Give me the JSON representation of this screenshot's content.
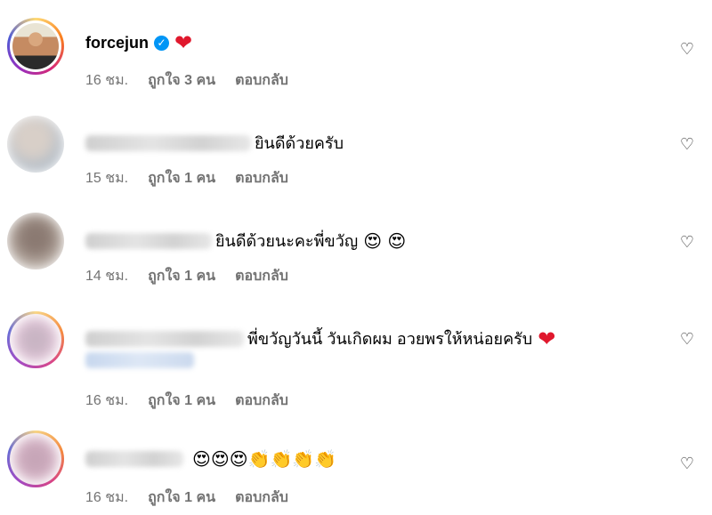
{
  "comments": [
    {
      "username": "forcejun",
      "verified": true,
      "text": "",
      "emoji": "❤",
      "time": "16 ชม.",
      "likes": "ถูกใจ 3 คน",
      "reply": "ตอบกลับ"
    },
    {
      "username": "",
      "text": "ยินดีด้วยครับ",
      "emoji": "",
      "time": "15 ชม.",
      "likes": "ถูกใจ 1 คน",
      "reply": "ตอบกลับ"
    },
    {
      "username": "",
      "text": "ยินดีด้วยนะคะพี่ขวัญ",
      "emoji": "😍 😍",
      "time": "14 ชม.",
      "likes": "ถูกใจ 1 คน",
      "reply": "ตอบกลับ"
    },
    {
      "username": "",
      "text": "พี่ขวัญวันนี้ วันเกิดผม อวยพรให้หน่อยครับ",
      "emoji": "❤",
      "time": "16 ชม.",
      "likes": "ถูกใจ 1 คน",
      "reply": "ตอบกลับ"
    },
    {
      "username": "",
      "text": "",
      "emoji": "😍😍😍👏👏👏👏",
      "time": "16 ชม.",
      "likes": "ถูกใจ 1 คน",
      "reply": "ตอบกลับ"
    }
  ],
  "icons": {
    "like": "heart-outline-icon",
    "verified": "verified-badge-icon"
  },
  "colors": {
    "verified": "#0095f6",
    "heart": "#e0182d",
    "meta": "#737373"
  }
}
